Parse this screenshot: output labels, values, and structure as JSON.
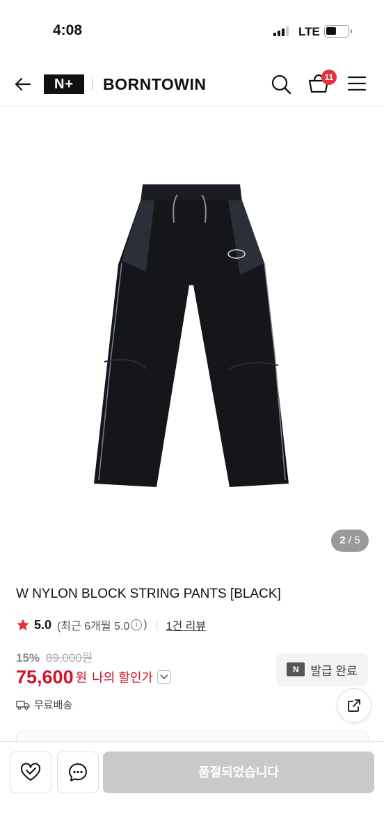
{
  "status_bar": {
    "time": "4:08",
    "network": "LTE"
  },
  "header": {
    "logo_mark": "N+",
    "brand": "BORNTOWIN",
    "cart_count": "11",
    "icons": [
      "back-arrow-icon",
      "search-icon",
      "cart-icon",
      "hamburger-menu-icon"
    ]
  },
  "gallery": {
    "current": "2",
    "total": "/ 5"
  },
  "product": {
    "title": "W NYLON BLOCK STRING PANTS [BLACK]",
    "rating": "5.0",
    "rating_recent_prefix": "(최근 6개월 5.0",
    "rating_recent_suffix": ")",
    "info_symbol": "i",
    "reviews": "1건 리뷰",
    "discount_pct": "15%",
    "original_price": "89,000원",
    "price": "75,600",
    "price_unit": "원",
    "my_discount": "나의 할인가",
    "coupon_mark": "N",
    "coupon_label": "발급 완료",
    "shipping": "무료배송"
  },
  "bottom_bar": {
    "soldout_label": "품절되었습니다"
  },
  "colors": {
    "accent_red": "#d3112a",
    "badge_red": "#e8303d",
    "soldout_gray": "#c9c9c9"
  }
}
